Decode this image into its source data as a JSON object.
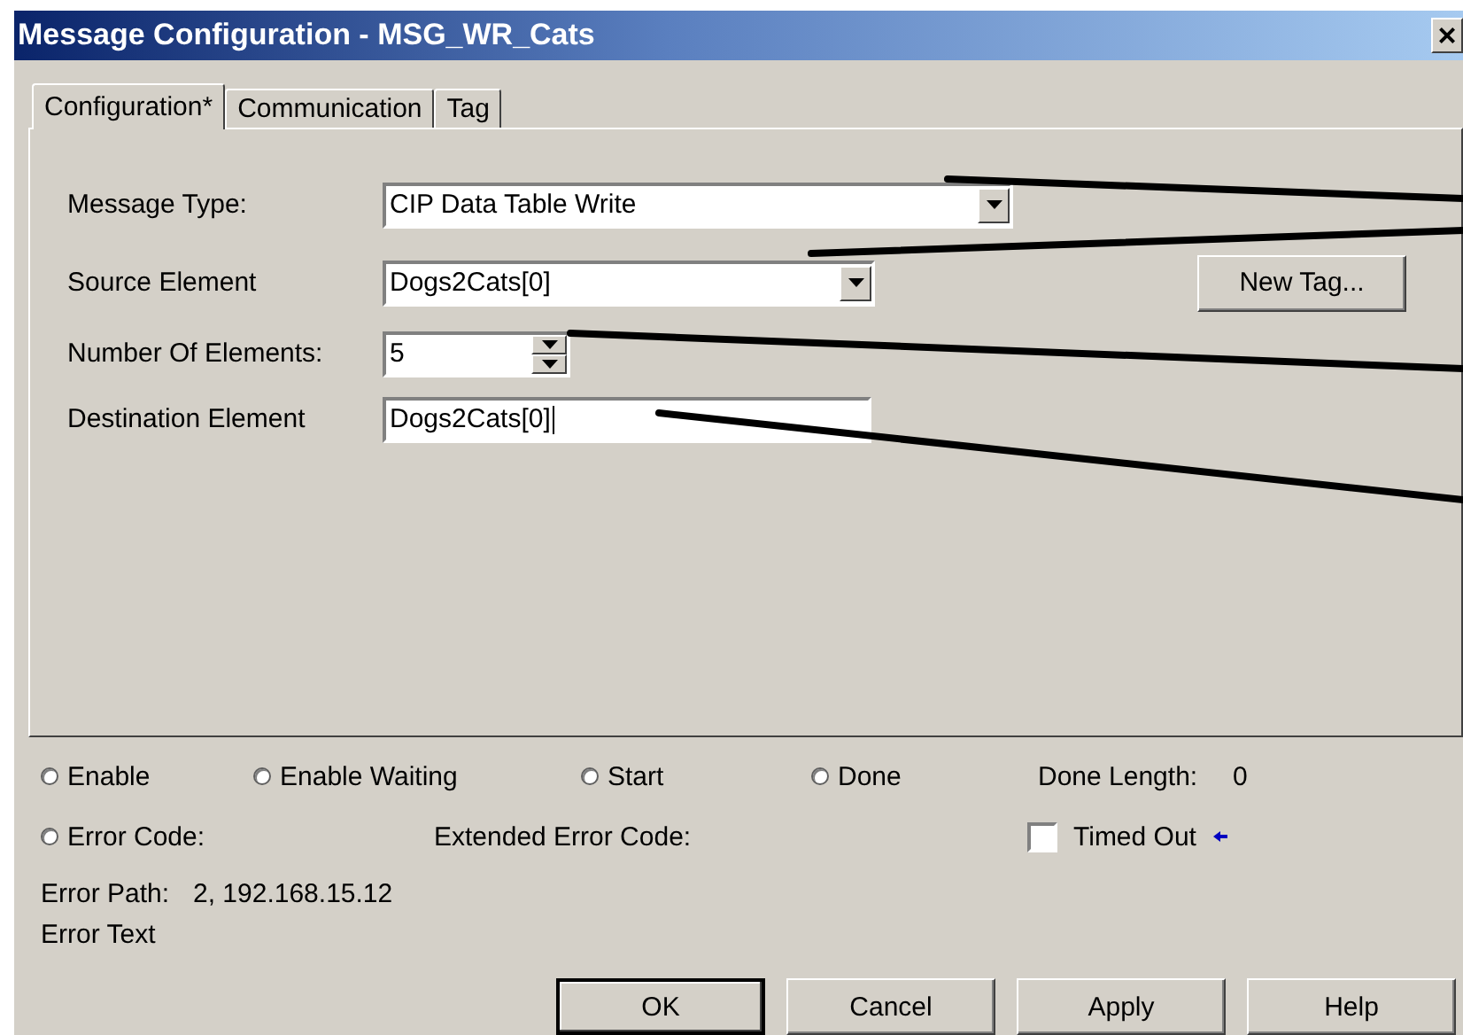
{
  "window": {
    "title": "Message Configuration - MSG_WR_Cats",
    "close": "×"
  },
  "tabs": [
    {
      "label": "Configuration*",
      "selected": true
    },
    {
      "label": "Communication",
      "selected": false
    },
    {
      "label": "Tag",
      "selected": false
    }
  ],
  "fields": [
    {
      "kind": "combo",
      "label": "Message Type:",
      "value": "CIP Data Table Write",
      "wide": true
    },
    {
      "kind": "combo",
      "label": "Source Element",
      "value": "Dogs2Cats[0]",
      "wide": false
    },
    {
      "kind": "spin",
      "label": "Number Of Elements:",
      "value": "5"
    },
    {
      "kind": "text",
      "label": "Destination Element",
      "value": "Dogs2Cats[0]",
      "focused": true
    }
  ],
  "new_tag_button": {
    "label": "New Tag..."
  },
  "status_indicators": [
    {
      "label": "Enable",
      "on": false
    },
    {
      "label": "Enable Waiting",
      "on": false
    },
    {
      "label": "Start",
      "on": false
    },
    {
      "label": "Done",
      "on": false
    }
  ],
  "done_length": {
    "label": "Done Length:",
    "value": "0"
  },
  "error_code": {
    "label": "Error Code:",
    "on": false
  },
  "extended_error_code": {
    "label": "Extended Error Code:"
  },
  "timed_out": {
    "label": "Timed Out",
    "checked": false
  },
  "error_path": {
    "label": "Error Path:",
    "value": "2, 192.168.15.12"
  },
  "error_text": {
    "label": "Error Text"
  },
  "buttons": [
    {
      "label": "OK",
      "default": true
    },
    {
      "label": "Cancel",
      "default": false
    },
    {
      "label": "Apply",
      "default": false
    },
    {
      "label": "Help",
      "default": false
    }
  ],
  "annotation_lines": [
    {
      "kind": "leader"
    },
    {
      "kind": "leader"
    },
    {
      "kind": "leader"
    },
    {
      "kind": "leader"
    }
  ]
}
